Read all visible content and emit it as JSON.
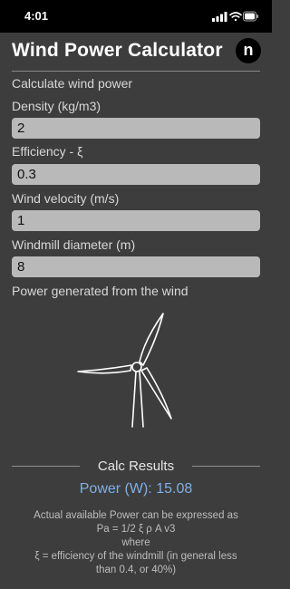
{
  "status": {
    "time": "4:01"
  },
  "header": {
    "title": "Wind Power Calculator",
    "brand_letter": "n"
  },
  "form": {
    "intro": "Calculate wind power",
    "density": {
      "label": "Density (kg/m3)",
      "value": "2"
    },
    "efficiency": {
      "label": "Efficiency - ξ",
      "value": "0.3"
    },
    "velocity": {
      "label": "Wind velocity (m/s)",
      "value": "1"
    },
    "diameter": {
      "label": "Windmill diameter (m)",
      "value": "8"
    },
    "illustration_caption": "Power generated from the wind"
  },
  "results": {
    "title": "Calc Results",
    "power": "Power (W): 15.08",
    "note_line1": "Actual available Power can be expressed as",
    "note_line2": "Pa = 1/2 ξ ρ A v3",
    "note_line3": "where",
    "note_line4": "ξ = efficiency of the windmill (in general less",
    "note_line5": "than 0.4, or 40%)"
  },
  "colors": {
    "background": "#3d3d3d",
    "field": "#b9b9b9",
    "result_accent": "#7fb0e6"
  }
}
